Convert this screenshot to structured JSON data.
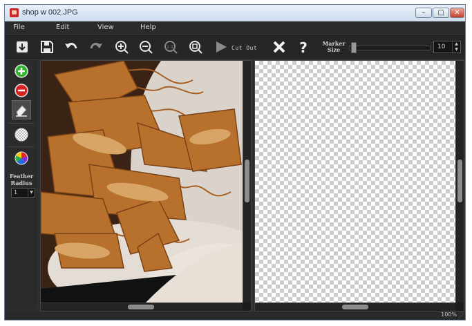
{
  "window": {
    "title": "shop w 002.JPG"
  },
  "menu": [
    "File",
    "Edit",
    "View",
    "Help"
  ],
  "toolbar": {
    "cutout_label": "Cut Out",
    "marker_label_1": "Marker",
    "marker_label_2": "Size",
    "marker_size": "10",
    "marker_level": 0.05
  },
  "left_tools": {
    "feather_label_1": "Feather",
    "feather_label_2": "Radius",
    "feather_value": "1"
  },
  "status": {
    "zoom": "100%"
  },
  "icons": {
    "toolbar": [
      "open-icon",
      "save-icon",
      "undo-icon",
      "redo-icon",
      "zoom-in-icon",
      "zoom-out-icon",
      "actual-size-icon",
      "fit-window-icon",
      "cut-out-play-icon",
      "close-x-icon",
      "help-icon"
    ],
    "left": [
      "add-green-icon",
      "remove-red-icon",
      "eraser-icon",
      "transparency-icon",
      "color-wheel-icon"
    ]
  },
  "colors": {
    "add": "#2fb52f",
    "remove": "#d92424",
    "background": "#2e2e2e"
  }
}
